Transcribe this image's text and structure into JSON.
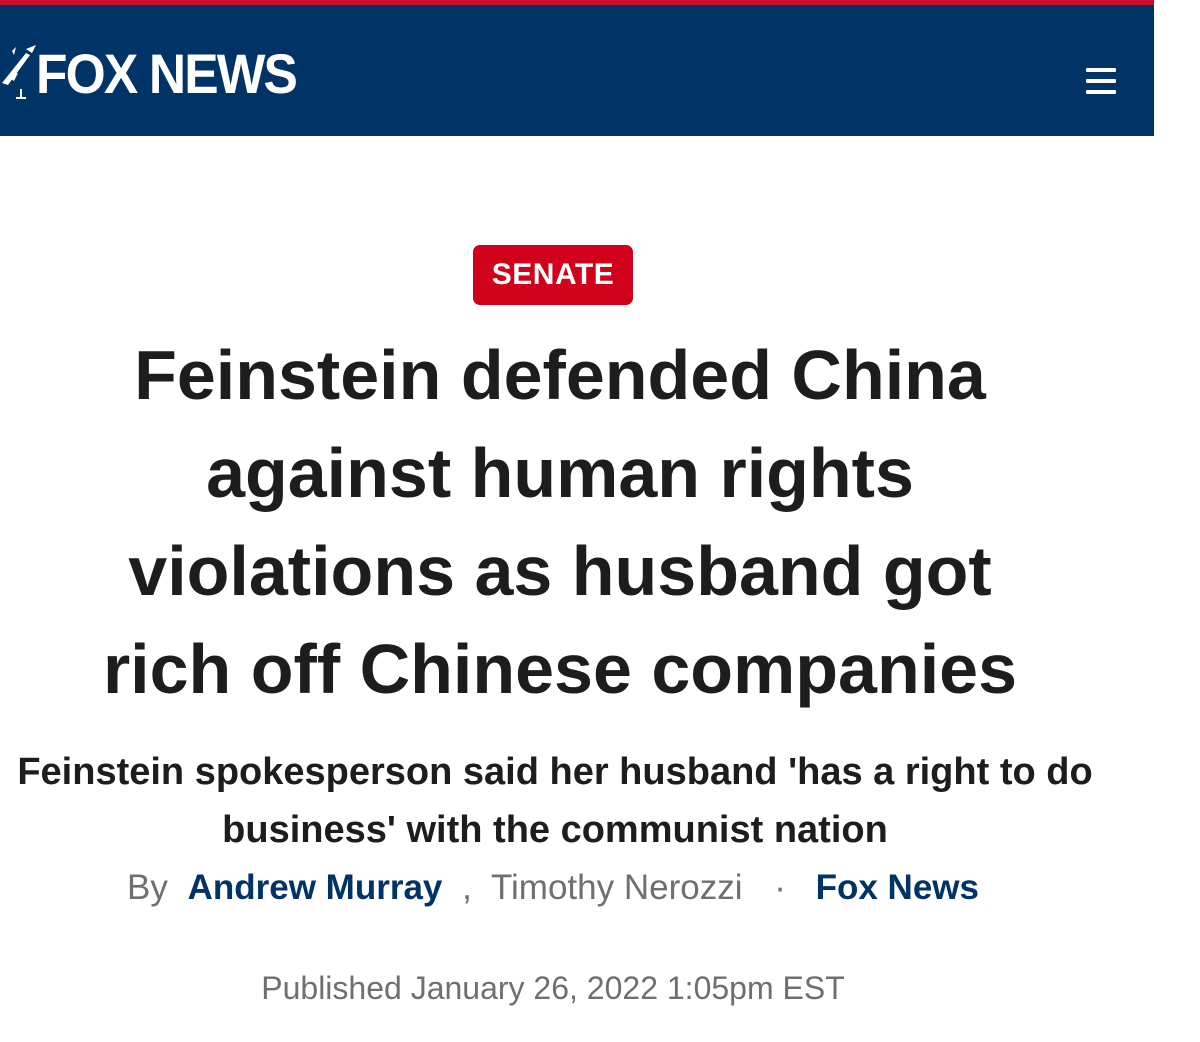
{
  "header": {
    "logo_text": "FOX NEWS",
    "menu_icon": "hamburger-menu-icon",
    "colors": {
      "header_bg": "#003366",
      "top_accent": "#c8102e"
    }
  },
  "article": {
    "kicker": "SENATE",
    "headline_lines": [
      "Feinstein defended China",
      "against human rights",
      "violations as husband got",
      "rich off Chinese companies"
    ],
    "subhead_lines": [
      "Feinstein spokesperson said her husband 'has a right to do",
      "business' with the communist nation"
    ],
    "byline": {
      "prefix": "By",
      "author_1": "Andrew Murray",
      "separator": ",",
      "author_2": "Timothy Nerozzi",
      "dot": "·",
      "source": "Fox News"
    },
    "published": "Published January 26, 2022 1:05pm EST",
    "colors": {
      "kicker_bg": "#d0021b",
      "link": "#003366",
      "meta_text": "#6f6f6f",
      "headline_text": "#1d1d1d"
    }
  }
}
